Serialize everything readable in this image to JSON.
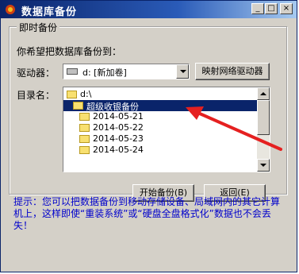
{
  "window": {
    "title": "数据库备份",
    "minimize": "_",
    "maximize": "□",
    "close": "×"
  },
  "group": {
    "legend": "即时备份"
  },
  "prompt": "你希望把数据库备份到：",
  "drive": {
    "label": "驱动器：",
    "value": "d: [新加卷]"
  },
  "map_button": "映射网络驱动器",
  "dir": {
    "label": "目录名：",
    "items": [
      {
        "text": "d:\\",
        "indent": 0,
        "selected": false
      },
      {
        "text": "超级收银备份",
        "indent": 1,
        "selected": true
      },
      {
        "text": "2014-05-21",
        "indent": 2,
        "selected": false
      },
      {
        "text": "2014-05-22",
        "indent": 2,
        "selected": false
      },
      {
        "text": "2014-05-23",
        "indent": 2,
        "selected": false
      },
      {
        "text": "2014-05-24",
        "indent": 2,
        "selected": false
      }
    ]
  },
  "buttons": {
    "start": "开始备份(B)",
    "back": "返回(E)"
  },
  "hint": "提示：您可以把数据备份到移动存储设备、局域网内的其它计算机上，这样即使“重装系统”或“硬盘全盘格式化”数据也不会丢失！",
  "colors": {
    "hint": "#0000cc",
    "arrow": "#e52020",
    "selection": "#0a246a"
  }
}
